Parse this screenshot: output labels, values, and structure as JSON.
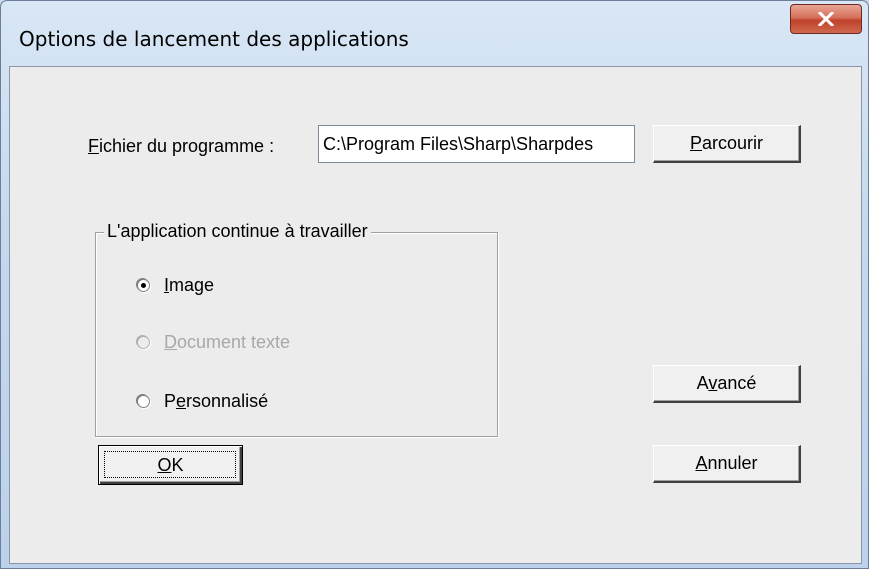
{
  "window": {
    "title": "Options de lancement des applications",
    "close_icon": "close-x-icon"
  },
  "file": {
    "label_mnemonic": "F",
    "label_rest": "ichier du programme :",
    "value": "C:\\Program Files\\Sharp\\Sharpdes"
  },
  "buttons": {
    "browse": {
      "mnemonic": "P",
      "rest": "arcourir"
    },
    "advanced": {
      "before": "A",
      "mnemonic": "v",
      "rest": "ancé"
    },
    "ok": {
      "mnemonic": "O",
      "rest": "K"
    },
    "cancel": {
      "mnemonic": "A",
      "rest": "nnuler"
    }
  },
  "group": {
    "title": "L'application continue à travailler",
    "options": [
      {
        "before": "",
        "mnemonic": "I",
        "rest": "mage",
        "checked": true,
        "disabled": false
      },
      {
        "before": "",
        "mnemonic": "D",
        "rest": "ocument texte",
        "checked": false,
        "disabled": true
      },
      {
        "before": "P",
        "mnemonic": "e",
        "rest": "rsonnalisé",
        "checked": false,
        "disabled": false
      }
    ]
  },
  "colors": {
    "close_button": "#c0412a",
    "dialog_background": "#ececec",
    "disabled_text": "#a8a8a8"
  }
}
